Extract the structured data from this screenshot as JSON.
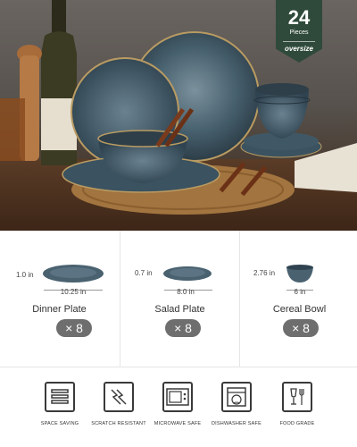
{
  "badge": {
    "count": "24",
    "unit": "Pieces",
    "tag": "oversize"
  },
  "products": [
    {
      "name": "Dinner Plate",
      "height": "1.0 in",
      "width": "10.25 in",
      "qty": "× 8"
    },
    {
      "name": "Salad Plate",
      "height": "0.7 in",
      "width": "8.0 in",
      "qty": "× 8"
    },
    {
      "name": "Cereal Bowl",
      "height": "2.76 in",
      "width": "6 in",
      "qty": "× 8"
    }
  ],
  "features": [
    {
      "label": "SPACE SAVING",
      "icon": "stacked-plates-icon"
    },
    {
      "label": "SCRATCH RESISTANT",
      "icon": "scratch-icon"
    },
    {
      "label": "MICROWAVE SAFE",
      "icon": "microwave-icon"
    },
    {
      "label": "DISHWASHER SAFE",
      "icon": "dishwasher-icon"
    },
    {
      "label": "FOOD GRADE",
      "icon": "glass-fork-icon"
    }
  ],
  "colors": {
    "badge": "#2f4a3a",
    "glaze": "#3d5666",
    "qty_pill": "#6e6e6e"
  }
}
